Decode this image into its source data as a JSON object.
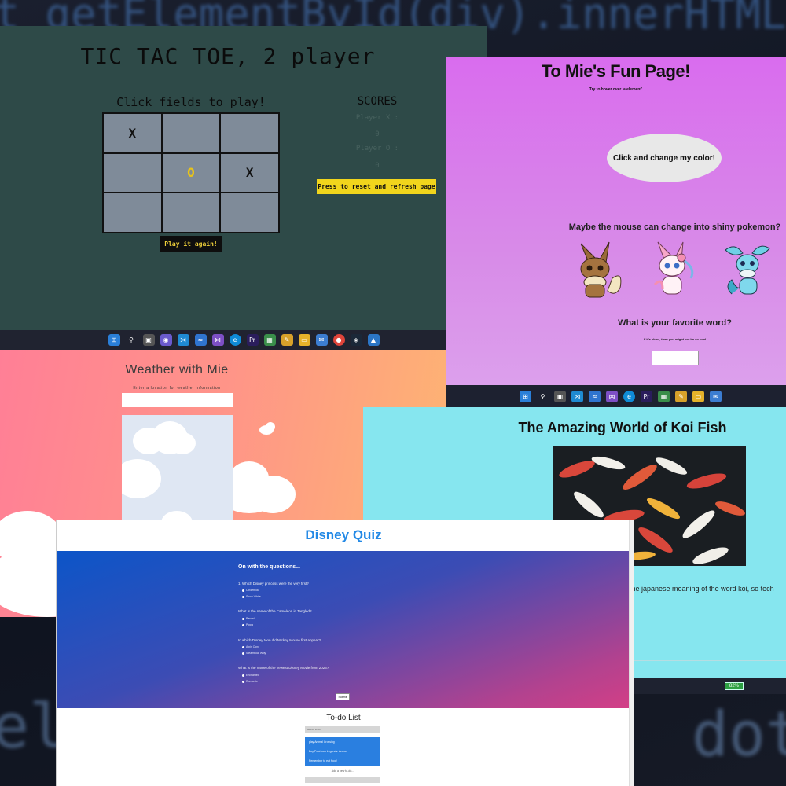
{
  "background": {
    "code_top": "ot  getElementById(div).innerHTML",
    "code_left": "el",
    "code_right": "dot"
  },
  "tictactoe": {
    "title": "TIC TAC TOE, 2 player",
    "subtitle": "Click fields to play!",
    "cells": [
      "X",
      "",
      "",
      "",
      "O",
      "X",
      "",
      "",
      ""
    ],
    "play_again": "Play it again!",
    "scores_title": "SCORES",
    "player_x_label": "Player X :",
    "player_x_score": "0",
    "player_o_label": "Player O :",
    "player_o_score": "0",
    "reset_button": "Press to reset and refresh page"
  },
  "fun_page": {
    "title": "To Mie's Fun Page!",
    "hint": "Try to hover over 'a element'",
    "color_button": "Click and change my color!",
    "mouse_heading": "Maybe the mouse can change into shiny pokemon?",
    "pokemon": [
      "eevee-icon",
      "sylveon-icon",
      "vaporeon-icon"
    ],
    "word_heading": "What is your favorite word?",
    "word_hint": "If it's short, then you might not be so cool"
  },
  "weather": {
    "title": "Weather with Mie",
    "subtitle": "Enter a location for weather information"
  },
  "koi": {
    "title": "The Amazing World of Koi Fish",
    "text": "s the japanese meaning of the word koi, so tech",
    "battery": "82%"
  },
  "disney": {
    "title": "Disney Quiz",
    "section_heading": "On with the questions...",
    "questions": [
      {
        "q": "1. Which Disney princess were the very first?",
        "options": [
          "Cinderella",
          "Snow White"
        ]
      },
      {
        "q": "What is the name of the Cameleon in Tangled?",
        "options": [
          "Pascal",
          "Pippa"
        ]
      },
      {
        "q": "In which Disney toon did Mickey Mouse first appear?",
        "options": [
          "Alpin Corp",
          "Steamboat Willy"
        ]
      },
      {
        "q": "What is the name of the newest Disney Movie from 2023?",
        "options": [
          "Enchanted",
          "Romantic"
        ]
      }
    ],
    "submit": "Submit",
    "todo_title": "To-do List",
    "todo_search": "search to-do",
    "todo_items": [
      "play Animal Crossing",
      "Buy Pokémon Legends: Arceus",
      "Remember to eat food!"
    ],
    "todo_add": "Add a new to-do..."
  },
  "colors": {
    "ttt_bg": "#2e4a48",
    "fun_bg": "#d96cee",
    "koi_bg": "#86e6ef",
    "disney_blue": "#2289e6",
    "yellow": "#f1d51c"
  }
}
